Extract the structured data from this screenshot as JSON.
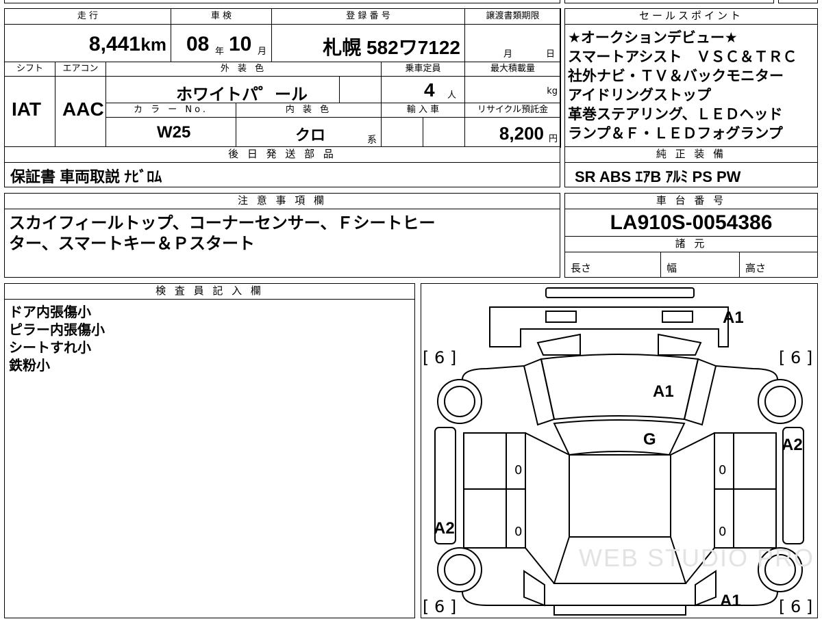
{
  "vehicle": {
    "mileage_label": "走 行",
    "mileage": "8,441",
    "mileage_unit": "km",
    "shaken_label": "車 検",
    "shaken_year": "08",
    "shaken_year_unit": "年",
    "shaken_month": "10",
    "shaken_month_unit": "月",
    "reg_label": "登 録 番 号",
    "reg_number": "札幌 582ワ7122",
    "transfer_label": "譲渡書類期限",
    "transfer_month_unit": "月",
    "transfer_day_unit": "日",
    "shift_label": "シフト",
    "shift": "IAT",
    "ac_label": "エアコン",
    "ac": "AAC",
    "ext_color_label": "外 装 色",
    "ext_color": "ホワイトパ゜ール",
    "capacity_label": "乗車定員",
    "capacity": "4",
    "capacity_unit": "人",
    "max_load_label": "最大積載量",
    "max_load_unit": "kg",
    "color_no_label": "カ ラ ー No.",
    "color_no": "W25",
    "int_color_label": "内 装 色",
    "int_color": "クロ",
    "int_color_unit": "系",
    "import_label": "輸 入 車",
    "recycle_label": "リサイクル預託金",
    "recycle": "8,200",
    "recycle_unit": "円"
  },
  "sales_points": {
    "label": "セールスポイント",
    "lines": [
      "★オークションデビュー★",
      "スマートアシスト　ＶＳＣ＆ＴＲＣ",
      "社外ナビ・ＴＶ＆バックモニター",
      "アイドリングストップ",
      "革巻ステアリング、ＬＥＤヘッド",
      "ランプ＆Ｆ・ＬＥＤフォグランプ"
    ]
  },
  "later_parts": {
    "label": "後 日 発 送 部 品",
    "value": "保証書 車両取説 ﾅﾋﾞﾛﾑ"
  },
  "genuine_equipment": {
    "label": "純 正 装 備",
    "value": "SR ABS ｴｱB ｱﾙﾐ PS PW"
  },
  "notes": {
    "label": "注 意 事 項 欄",
    "lines": [
      "スカイフィールトップ、コーナーセンサー、Ｆシートヒー",
      "ター、スマートキー＆Ｐスタート"
    ]
  },
  "chassis": {
    "label": "車 台 番 号",
    "value": "LA910S-0054386"
  },
  "specs": {
    "label": "諸 元",
    "length": "長さ",
    "width": "幅",
    "height": "高さ"
  },
  "inspector": {
    "label": "検 査 員 記 入 欄",
    "lines": [
      "ドア内張傷小",
      "ピラー内張傷小",
      "シートすれ小",
      "鉄粉小"
    ]
  },
  "diagram": {
    "marks": {
      "front_right": "A1",
      "hood": "A1",
      "roof": "G",
      "right_side": "A2",
      "left_side": "A2",
      "rear_right": "A1"
    },
    "tires": [
      "6",
      "6",
      "6",
      "6"
    ],
    "door_zeros": [
      "0",
      "0",
      "0",
      "0"
    ],
    "watermark": "WEB STUDIO PRO"
  }
}
